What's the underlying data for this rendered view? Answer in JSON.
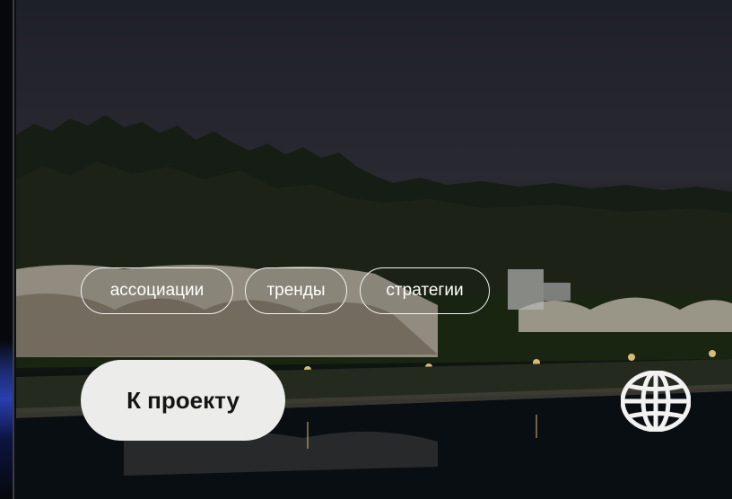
{
  "tags": [
    {
      "label": "ассоциации"
    },
    {
      "label": "тренды"
    },
    {
      "label": "стратегии"
    }
  ],
  "cta": {
    "label": "К проекту"
  },
  "icons": {
    "globe": "globe-icon"
  },
  "colors": {
    "chip_border": "#f2f2f2",
    "cta_background": "#ececea",
    "cta_text": "#141414",
    "sky": "#2a2b34",
    "water": "#0a0d12"
  }
}
